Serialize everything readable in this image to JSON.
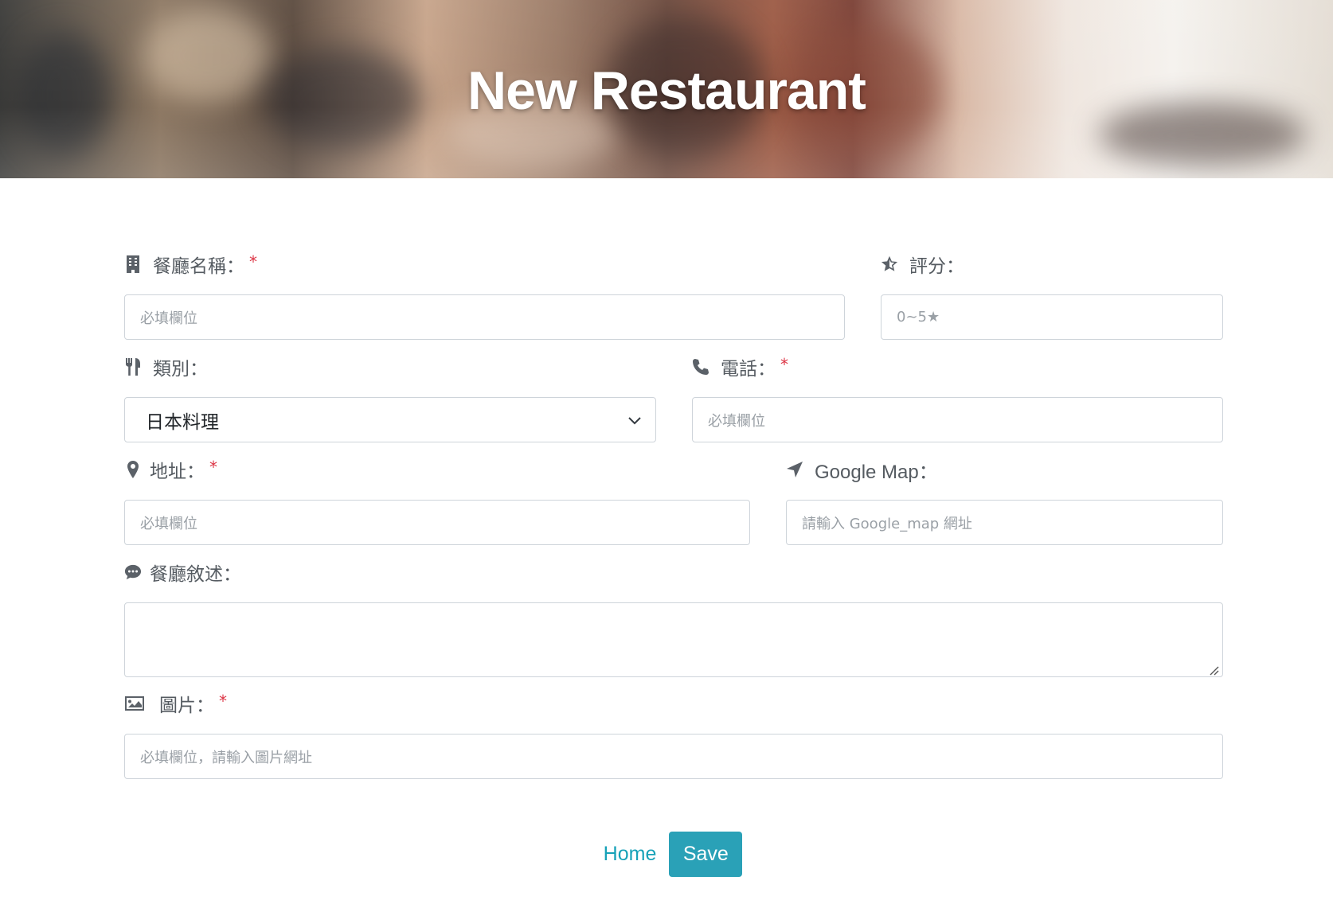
{
  "header": {
    "title": "New Restaurant"
  },
  "form": {
    "name": {
      "label": "餐廳名稱：",
      "required": "*",
      "placeholder": "必填欄位",
      "icon": "building-icon"
    },
    "rating": {
      "label": "評分：",
      "placeholder": "0~5★",
      "icon": "star-half-icon"
    },
    "category": {
      "label": "類別：",
      "value": "日本料理",
      "icon": "utensils-icon"
    },
    "phone": {
      "label": "電話：",
      "required": "*",
      "placeholder": "必填欄位",
      "icon": "phone-icon"
    },
    "address": {
      "label": "地址：",
      "required": "*",
      "placeholder": "必填欄位",
      "icon": "map-marker-icon"
    },
    "google_map": {
      "label": "Google Map：",
      "placeholder": "請輸入 Google_map 網址",
      "icon": "location-arrow-icon"
    },
    "description": {
      "label": "餐廳敘述：",
      "placeholder": "",
      "icon": "comment-dots-icon"
    },
    "image": {
      "label": "圖片：",
      "required": "*",
      "placeholder": "必填欄位，請輸入圖片網址",
      "icon": "image-icon"
    }
  },
  "actions": {
    "home_label": "Home",
    "save_label": "Save"
  },
  "colors": {
    "accent": "#17a2b8",
    "save_bg": "#2aa1b7",
    "required": "#dc3545",
    "border": "#ced4da"
  }
}
